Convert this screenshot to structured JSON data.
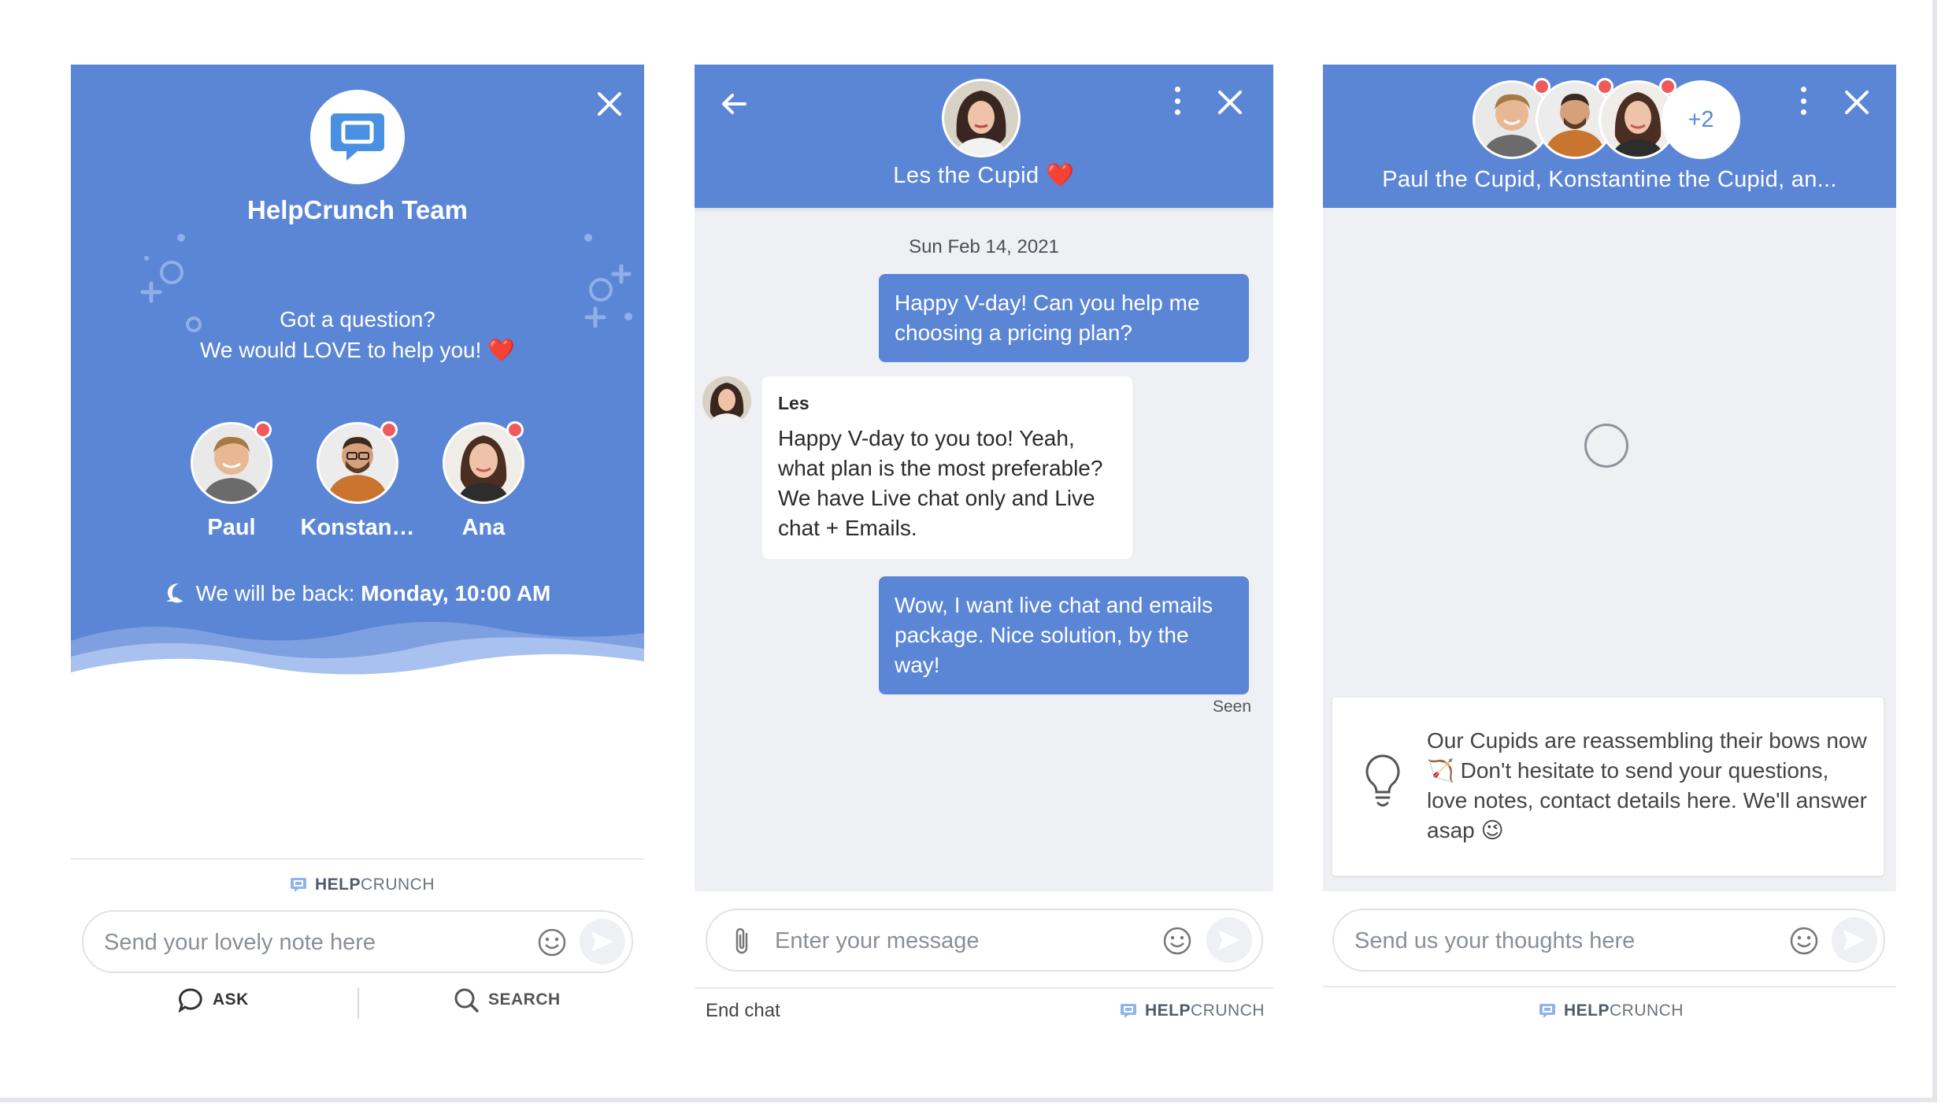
{
  "panel1": {
    "title": "HelpCrunch Team",
    "question_line1": "Got a question?",
    "question_line2": "We would LOVE to help you! ❤️",
    "agents": [
      {
        "name": "Paul"
      },
      {
        "name": "Konstan…"
      },
      {
        "name": "Ana"
      }
    ],
    "back_prefix": "We will be back:",
    "back_time": "Monday, 10:00 AM",
    "powered_bold": "HELP",
    "powered_rest": "CRUNCH",
    "input_placeholder": "Send your lovely note here",
    "tab_ask": "ASK",
    "tab_search": "SEARCH"
  },
  "panel2": {
    "agent_name": "Les the Cupid ❤️",
    "date": "Sun Feb 14, 2021",
    "messages": [
      {
        "from": "user",
        "text": "Happy V-day! Can you help me choosing a pricing plan?"
      },
      {
        "from": "agent",
        "sender": "Les",
        "text": "Happy V-day to you too! Yeah, what plan is the most preferable? We have Live chat only and Live chat + Emails."
      },
      {
        "from": "user",
        "text": "Wow, I want live chat and emails package. Nice solution, by the way!"
      }
    ],
    "seen": "Seen",
    "input_placeholder": "Enter your message",
    "end_chat": "End chat",
    "powered_bold": "HELP",
    "powered_rest": "CRUNCH"
  },
  "panel3": {
    "extra_count": "+2",
    "team_name": "Paul the Cupid, Konstantine the Cupid, an...",
    "notice": "Our Cupids are reassembling their bows now 🏹 Don't hesitate to send your questions, love notes, contact details here. We'll answer asap 😉",
    "input_placeholder": "Send us your thoughts here",
    "powered_bold": "HELP",
    "powered_rest": "CRUNCH"
  },
  "colors": {
    "brand_blue": "#5b86d6",
    "background_grey": "#eff0f4",
    "status_dot": "#ef5b5b"
  },
  "icons": [
    "close-icon",
    "back-arrow-icon",
    "more-vertical-icon",
    "smile-icon",
    "send-icon",
    "paperclip-icon",
    "chat-bubble-icon",
    "search-icon",
    "moon-icon",
    "lightbulb-icon",
    "helpcrunch-logo-icon"
  ]
}
